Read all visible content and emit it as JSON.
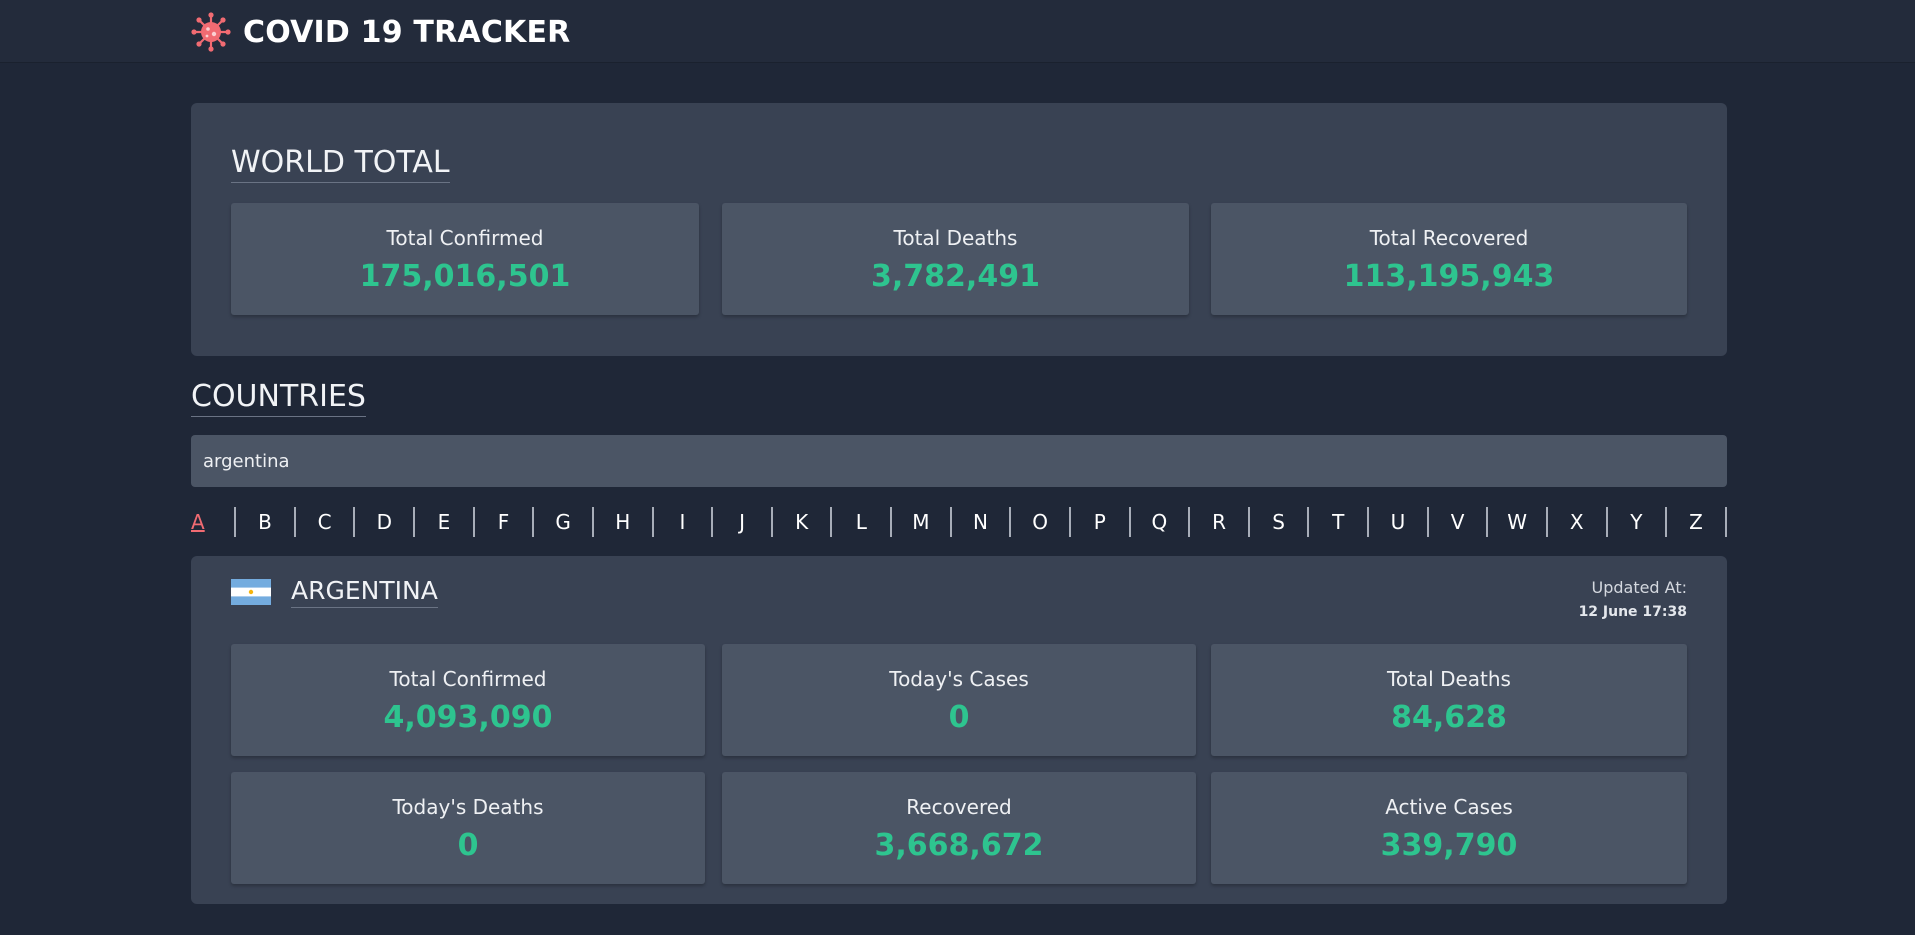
{
  "header": {
    "title": "COVID 19 TRACKER",
    "icon": "virus-icon",
    "icon_color": "#f16b72"
  },
  "world": {
    "title": "WORLD TOTAL",
    "stats": [
      {
        "label": "Total Confirmed",
        "value": "175,016,501"
      },
      {
        "label": "Total Deaths",
        "value": "3,782,491"
      },
      {
        "label": "Total Recovered",
        "value": "113,195,943"
      }
    ]
  },
  "countries": {
    "title": "COUNTRIES",
    "search": {
      "value": "argentina",
      "placeholder": ""
    },
    "alphabet": [
      "A",
      "B",
      "C",
      "D",
      "E",
      "F",
      "G",
      "H",
      "I",
      "J",
      "K",
      "L",
      "M",
      "N",
      "O",
      "P",
      "Q",
      "R",
      "S",
      "T",
      "U",
      "V",
      "W",
      "X",
      "Y",
      "Z"
    ],
    "active_letter": "A"
  },
  "country": {
    "name": "ARGENTINA",
    "flag": "argentina-flag-icon",
    "updated_label": "Updated At:",
    "updated_value": "12 June 17:38",
    "stats": [
      {
        "label": "Total Confirmed",
        "value": "4,093,090"
      },
      {
        "label": "Today's Cases",
        "value": "0"
      },
      {
        "label": "Total Deaths",
        "value": "84,628"
      },
      {
        "label": "Today's Deaths",
        "value": "0"
      },
      {
        "label": "Recovered",
        "value": "3,668,672"
      },
      {
        "label": "Active Cases",
        "value": "339,790"
      }
    ]
  },
  "colors": {
    "background": "#1f2737",
    "panel": "#394253",
    "card": "#4b5565",
    "value_green": "#2ec48f",
    "accent_red": "#f16b72"
  }
}
